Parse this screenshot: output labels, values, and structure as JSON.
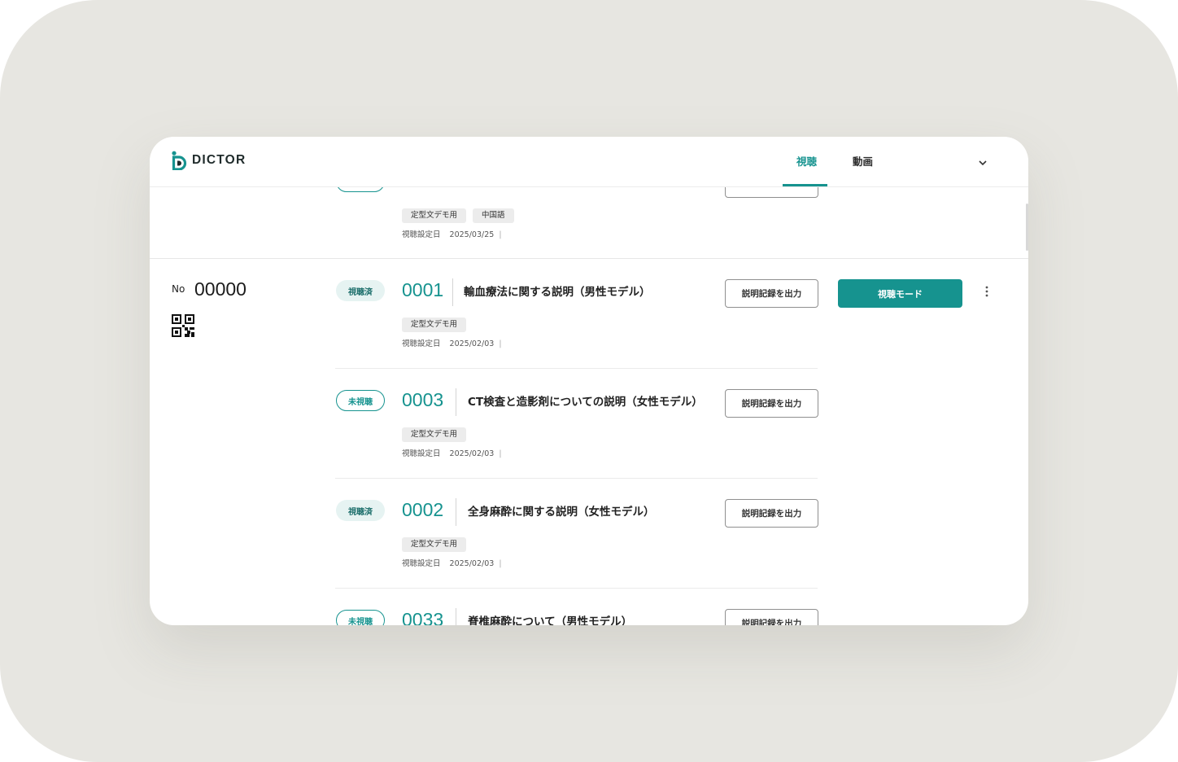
{
  "app": {
    "name": "DICTOR"
  },
  "nav": {
    "tabs": [
      {
        "label": "視聴",
        "active": true
      },
      {
        "label": "動画",
        "active": false
      }
    ]
  },
  "colors": {
    "accent": "#16938f",
    "viewed_badge_bg": "#e6f3f2",
    "background": "#e7e6e1"
  },
  "previous_entry": {
    "tags": [
      "定型文デモ用",
      "中国語"
    ],
    "date_label": "視聴設定日",
    "date": "2025/03/25"
  },
  "group": {
    "no_label": "No",
    "no": "00000",
    "mode_button": "視聴モード"
  },
  "entries": [
    {
      "status": "視聴済",
      "status_type": "viewed",
      "number": "0001",
      "title": "輸血療法に関する説明（男性モデル）",
      "tags": [
        "定型文デモ用"
      ],
      "date_label": "視聴設定日",
      "date": "2025/02/03",
      "export_button": "説明記録を出力"
    },
    {
      "status": "未視聴",
      "status_type": "unviewed",
      "number": "0003",
      "title": "CT検査と造影剤についての説明（女性モデル）",
      "tags": [
        "定型文デモ用"
      ],
      "date_label": "視聴設定日",
      "date": "2025/02/03",
      "export_button": "説明記録を出力"
    },
    {
      "status": "視聴済",
      "status_type": "viewed",
      "number": "0002",
      "title": "全身麻酔に関する説明（女性モデル）",
      "tags": [
        "定型文デモ用"
      ],
      "date_label": "視聴設定日",
      "date": "2025/02/03",
      "export_button": "説明記録を出力"
    },
    {
      "status": "未視聴",
      "status_type": "unviewed",
      "number": "0033",
      "title": "脊椎麻酔について（男性モデル）",
      "tags": [],
      "date_label": "",
      "date": "",
      "export_button": "説明記録を出力"
    }
  ]
}
